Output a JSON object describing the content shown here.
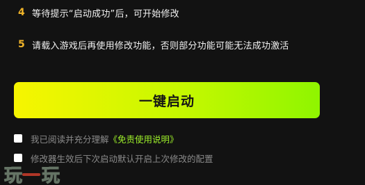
{
  "steps": [
    {
      "num": "4",
      "text": "等待提示“启动成功”后，可开始修改"
    },
    {
      "num": "5",
      "text": "请载入游戏后再使用修改功能，否则部分功能可能无法成功激活"
    }
  ],
  "launch_button": {
    "label": "一键启动"
  },
  "agreement": {
    "text": "我已阅读并充分理解",
    "link": "《免责使用说明》"
  },
  "auto_enable": {
    "text": "修改器生效后下次启动默认开启上次修改的配置"
  },
  "watermark": {
    "left": "玩",
    "right": "玩"
  },
  "colors": {
    "accent": "#9ef02a",
    "step_number": "#f0b429",
    "button_gradient_start": "#f7f500",
    "button_gradient_end": "#8ff500"
  }
}
